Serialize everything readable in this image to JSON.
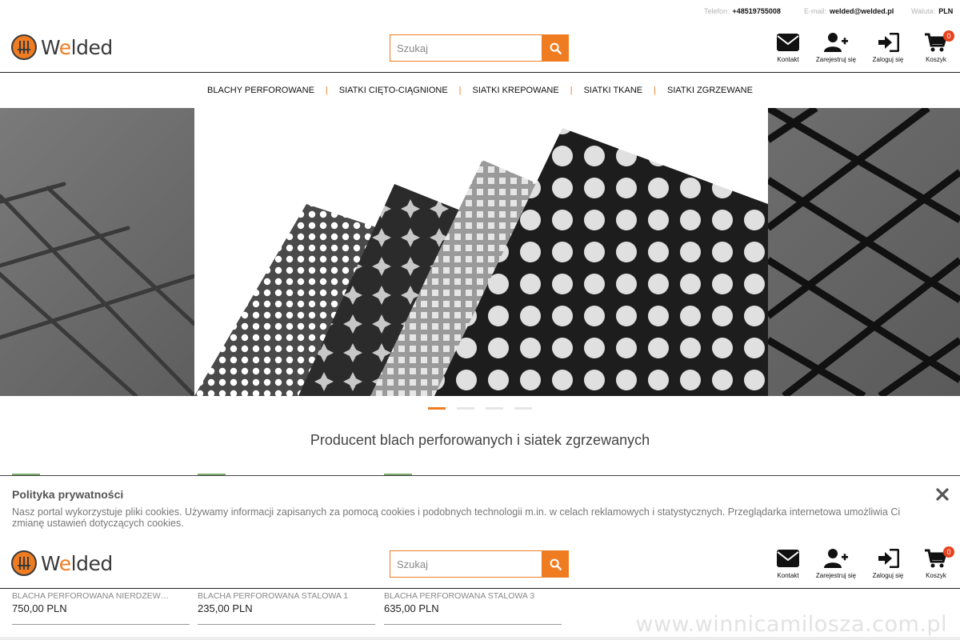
{
  "topbar": {
    "phone_label": "Telefon:",
    "phone": "+48519755008",
    "email_label": "E-mail:",
    "email": "welded@welded.pl",
    "currency_label": "Waluta:",
    "currency": "PLN"
  },
  "brand": {
    "pre": "W",
    "accent": "e",
    "post": "lded",
    "accent_color": "#f07c22"
  },
  "search": {
    "placeholder": "Szukaj",
    "icon": "search-icon"
  },
  "actions": {
    "contact": "Kontakt",
    "register": "Zarejestruj się",
    "login": "Zaloguj się",
    "cart": "Koszyk",
    "cart_count": "0"
  },
  "nav": [
    "BLACHY PERFOROWANE",
    "SIATKI CIĘTO-CIĄGNIONE",
    "SIATKI KREPOWANE",
    "SIATKI TKANE",
    "SIATKI ZGRZEWANE"
  ],
  "slider": {
    "slide_count": 4,
    "active_index": 0
  },
  "tagline": "Producent blach perforowanych i siatek zgrzewanych",
  "cookie": {
    "title": "Polityka prywatności",
    "text": "Nasz portal wykorzystuje pliki cookies. Używamy informacji zapisanych za pomocą cookies i podobnych technologii m.in. w celach reklamowych i statystycznych. Przeglądarka internetowa umożliwia Ci zmianę ustawień dotyczących cookies."
  },
  "products": [
    {
      "name": "BLACHA PERFOROWANA NIERDZEWNA",
      "price": "750,00 PLN"
    },
    {
      "name": "BLACHA PERFOROWANA STALOWA 1",
      "price": "235,00 PLN"
    },
    {
      "name": "BLACHA PERFOROWANA STALOWA 3",
      "price": "635,00 PLN"
    }
  ],
  "watermark": "www.winnicamilosza.com.pl"
}
